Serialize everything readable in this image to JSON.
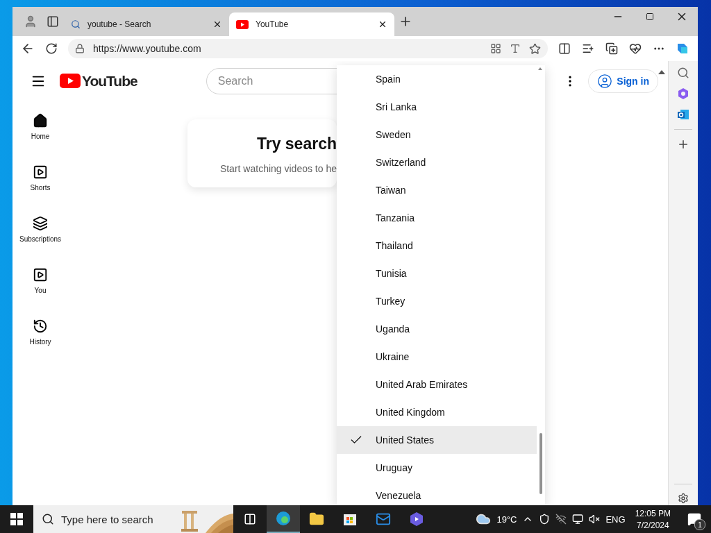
{
  "browser": {
    "tabs": [
      {
        "title": "youtube - Search",
        "kind": "search",
        "selected": false
      },
      {
        "title": "YouTube",
        "kind": "youtube",
        "selected": true
      }
    ],
    "address": "https://www.youtube.com"
  },
  "youtube": {
    "logo": "YouTube",
    "search_placeholder": "Search",
    "sign_in": "Sign in",
    "guide": [
      {
        "label": "Home",
        "kind": "home"
      },
      {
        "label": "Shorts",
        "kind": "shorts"
      },
      {
        "label": "Subscriptions",
        "kind": "subscriptions"
      },
      {
        "label": "You",
        "kind": "you"
      },
      {
        "label": "History",
        "kind": "history"
      }
    ],
    "card": {
      "title": "Try search",
      "text": "Start watching videos to he"
    }
  },
  "country_menu": {
    "items": [
      {
        "label": "Spain",
        "selected": false
      },
      {
        "label": "Sri Lanka",
        "selected": false
      },
      {
        "label": "Sweden",
        "selected": false
      },
      {
        "label": "Switzerland",
        "selected": false
      },
      {
        "label": "Taiwan",
        "selected": false
      },
      {
        "label": "Tanzania",
        "selected": false
      },
      {
        "label": "Thailand",
        "selected": false
      },
      {
        "label": "Tunisia",
        "selected": false
      },
      {
        "label": "Turkey",
        "selected": false
      },
      {
        "label": "Uganda",
        "selected": false
      },
      {
        "label": "Ukraine",
        "selected": false
      },
      {
        "label": "United Arab Emirates",
        "selected": false
      },
      {
        "label": "United Kingdom",
        "selected": false
      },
      {
        "label": "United States",
        "selected": true
      },
      {
        "label": "Uruguay",
        "selected": false
      },
      {
        "label": "Venezuela",
        "selected": false
      }
    ]
  },
  "taskbar": {
    "search_placeholder": "Type here to search",
    "weather": "19°C",
    "language": "ENG",
    "time": "12:05 PM",
    "date": "7/2/2024",
    "notifications": "1"
  }
}
